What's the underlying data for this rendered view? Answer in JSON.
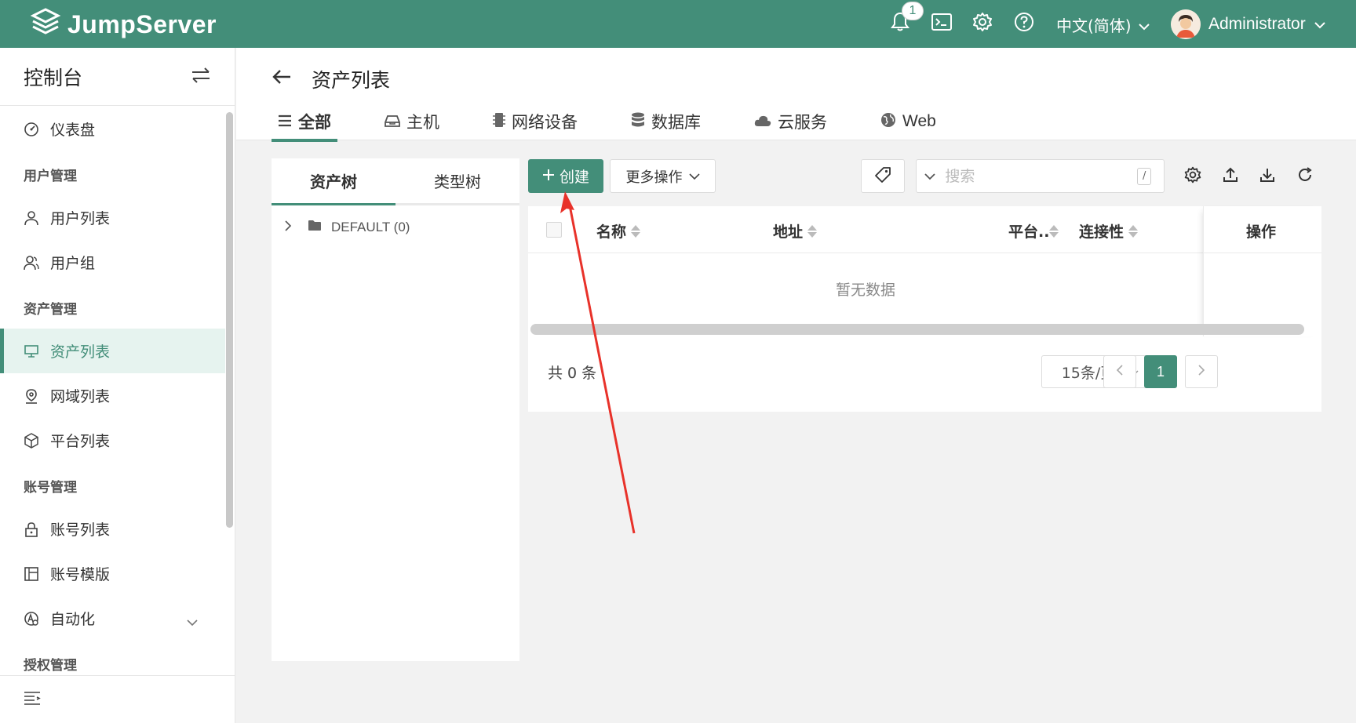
{
  "app": {
    "brand": "JumpServer",
    "notification_count": "1",
    "language": "中文(简体)",
    "username": "Administrator"
  },
  "sidebar": {
    "title": "控制台",
    "items": [
      {
        "type": "item",
        "label": "仪表盘",
        "icon": "dashboard-icon"
      },
      {
        "type": "group",
        "label": "用户管理"
      },
      {
        "type": "item",
        "label": "用户列表",
        "icon": "user-icon"
      },
      {
        "type": "item",
        "label": "用户组",
        "icon": "user-group-icon"
      },
      {
        "type": "group",
        "label": "资产管理"
      },
      {
        "type": "item",
        "label": "资产列表",
        "icon": "monitor-icon",
        "active": true
      },
      {
        "type": "item",
        "label": "网域列表",
        "icon": "location-icon"
      },
      {
        "type": "item",
        "label": "平台列表",
        "icon": "cube-icon"
      },
      {
        "type": "group",
        "label": "账号管理"
      },
      {
        "type": "item",
        "label": "账号列表",
        "icon": "lock-icon"
      },
      {
        "type": "item",
        "label": "账号模版",
        "icon": "template-icon"
      },
      {
        "type": "item",
        "label": "自动化",
        "icon": "automation-icon",
        "expandable": true
      },
      {
        "type": "group",
        "label": "授权管理"
      }
    ]
  },
  "page": {
    "title": "资产列表",
    "tabs": [
      {
        "label": "全部",
        "icon": "list-icon",
        "active": true
      },
      {
        "label": "主机",
        "icon": "host-icon"
      },
      {
        "label": "网络设备",
        "icon": "chip-icon"
      },
      {
        "label": "数据库",
        "icon": "database-icon"
      },
      {
        "label": "云服务",
        "icon": "cloud-icon"
      },
      {
        "label": "Web",
        "icon": "globe-icon"
      }
    ]
  },
  "tree": {
    "tabs": [
      "资产树",
      "类型树"
    ],
    "node": "DEFAULT (0)"
  },
  "toolbar": {
    "create_label": "创建",
    "more_label": "更多操作",
    "search_placeholder": "搜索",
    "search_shortcut": "/"
  },
  "table": {
    "columns": [
      "名称",
      "地址",
      "平台..",
      "连接性",
      "操作"
    ],
    "empty_text": "暂无数据",
    "total_text": "共 0 条",
    "page_size": "15条/页",
    "current_page": "1"
  },
  "colors": {
    "primary": "#438e79",
    "annotation_arrow": "#e8322a"
  }
}
